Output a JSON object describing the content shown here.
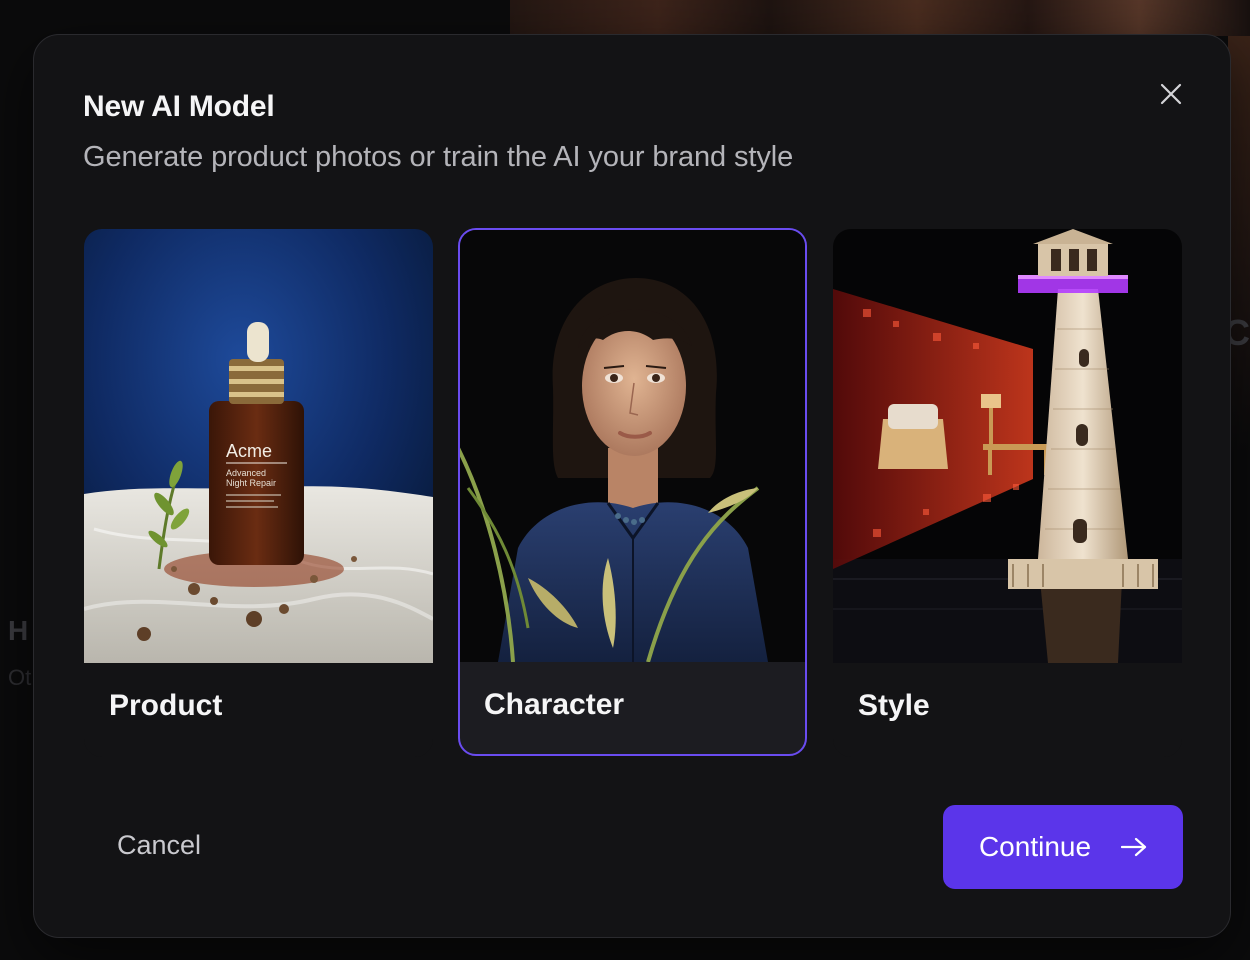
{
  "dialog": {
    "title": "New AI Model",
    "subtitle": "Generate product photos or train the AI your brand style"
  },
  "cards": [
    {
      "label": "Product",
      "selected": false,
      "image_icon": "serum-bottle-photo",
      "bottle_brand": "Acme",
      "bottle_lines": [
        "Advanced",
        "Night Repair"
      ]
    },
    {
      "label": "Character",
      "selected": true,
      "image_icon": "portrait-photo"
    },
    {
      "label": "Style",
      "selected": false,
      "image_icon": "lighthouse-render-photo"
    }
  ],
  "footer": {
    "cancel_label": "Cancel",
    "continue_label": "Continue"
  },
  "colors": {
    "accent": "#5b35ea",
    "selected_border": "#6a4cf0",
    "modal_bg": "#131315"
  },
  "background": {
    "left_text_1": "H",
    "left_text_2": "Ot",
    "right_text": "C"
  }
}
